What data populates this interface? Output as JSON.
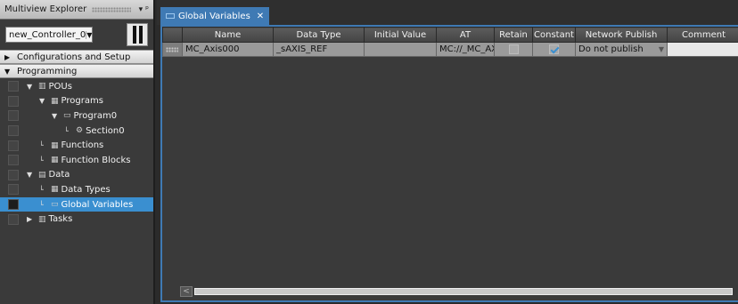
{
  "explorer": {
    "title": "Multiview Explorer",
    "pin_glyph": "▾",
    "close_glyph": "ᵖ",
    "controller": "new_Controller_0",
    "controller_dd": "▼",
    "sections": [
      {
        "label": "Configurations and Setup",
        "expanded": false,
        "toggle": "▶"
      },
      {
        "label": "Programming",
        "expanded": true,
        "toggle": "▼"
      }
    ],
    "tree": [
      {
        "label": "POUs",
        "icon": "▥",
        "expander": "▼",
        "indent": 0
      },
      {
        "label": "Programs",
        "icon": "▦",
        "expander": "▼",
        "indent": 1
      },
      {
        "label": "Program0",
        "icon": "▭",
        "expander": "▼",
        "indent": 2
      },
      {
        "label": "Section0",
        "icon": "⚙",
        "expander": "└",
        "indent": 3
      },
      {
        "label": "Functions",
        "icon": "▦",
        "expander": "└",
        "indent": 1
      },
      {
        "label": "Function Blocks",
        "icon": "▦",
        "expander": "└",
        "indent": 1
      },
      {
        "label": "Data",
        "icon": "▤",
        "expander": "▼",
        "indent": 0
      },
      {
        "label": "Data Types",
        "icon": "▦",
        "expander": "└",
        "indent": 1
      },
      {
        "label": "Global Variables",
        "icon": "▭",
        "expander": "└",
        "indent": 1,
        "selected": true
      },
      {
        "label": "Tasks",
        "icon": "▥",
        "expander": "▶",
        "indent": 0
      }
    ]
  },
  "tab": {
    "label": "Global Variables",
    "close": "✕"
  },
  "table": {
    "columns": [
      "Name",
      "Data Type",
      "Initial Value",
      "AT",
      "Retain",
      "Constant",
      "Network Publish",
      "Comment"
    ],
    "rows": [
      {
        "name": "MC_Axis000",
        "data_type": "_sAXIS_REF",
        "initial_value": "",
        "at": "MC://_MC_AX|",
        "retain": false,
        "constant": true,
        "network_publish": "Do not publish",
        "comment": ""
      }
    ]
  },
  "scroll": {
    "left_arrow": "<"
  },
  "colors": {
    "accent": "#3f7ab4",
    "selected": "#3a8fd0",
    "background": "#2b2b2b"
  }
}
